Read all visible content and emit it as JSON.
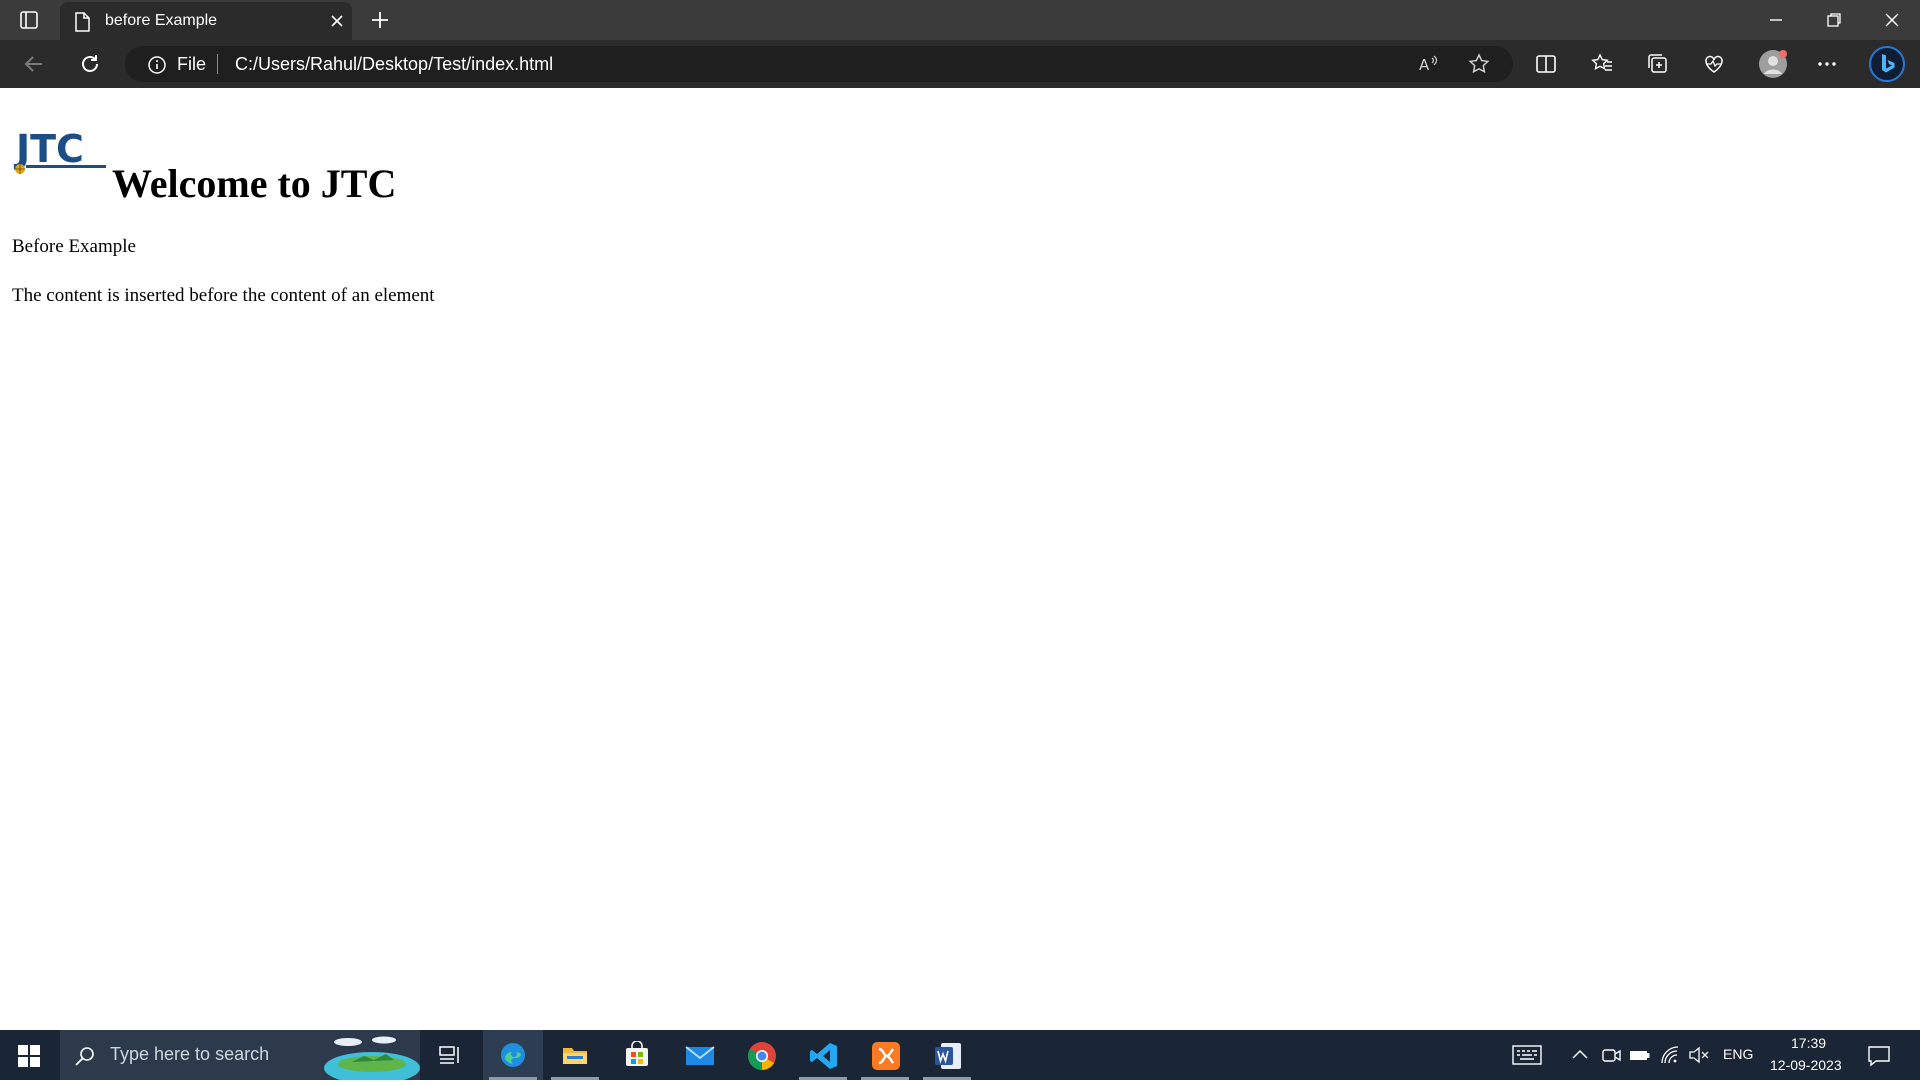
{
  "browser": {
    "tab_title": "before Example",
    "address": {
      "scheme_label": "File",
      "url": "C:/Users/Rahul/Desktop/Test/index.html"
    }
  },
  "page": {
    "logo_text": "JTC",
    "heading": "Welcome to JTC",
    "paragraph_1": "Before Example",
    "paragraph_2": "The content is inserted before the content of an element"
  },
  "taskbar": {
    "search_placeholder": "Type here to search",
    "apps": [
      "task-view",
      "edge",
      "file-explorer",
      "microsoft-store",
      "mail",
      "chrome",
      "vs-code",
      "xampp",
      "word"
    ],
    "tray": {
      "language": "ENG",
      "time": "17:39",
      "date": "12-09-2023"
    }
  },
  "colors": {
    "titlebar_bg": "#3b3b3b",
    "toolbar_bg": "#2b2b2b",
    "taskbar_bg": "#1a2636",
    "logo_blue": "#1b4e86"
  }
}
